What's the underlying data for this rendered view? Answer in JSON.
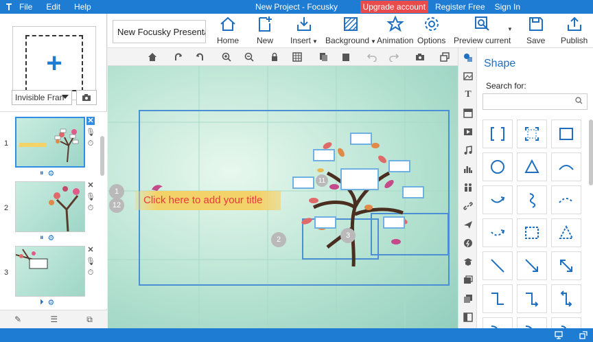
{
  "titlebar": {
    "menu": [
      "File",
      "Edit",
      "Help"
    ],
    "title": "New Project - Focusky",
    "upgrade": "Upgrade account",
    "register": "Register Free",
    "signin": "Sign In"
  },
  "toolbar": {
    "project_name": "New Focusky Presenta",
    "buttons": {
      "home": "Home",
      "new": "New",
      "insert": "Insert",
      "background": "Background",
      "animation": "Animation",
      "options": "Options",
      "preview": "Preview current",
      "save": "Save",
      "publish": "Publish"
    }
  },
  "left_panel": {
    "frame_type": "Invisible Fran",
    "slides": [
      {
        "number": "1",
        "selected": true
      },
      {
        "number": "2",
        "selected": false
      },
      {
        "number": "3",
        "selected": false
      }
    ]
  },
  "canvas": {
    "title_placeholder": "Click here to add your title",
    "bubbles": [
      "1",
      "12",
      "2",
      "3",
      "11"
    ]
  },
  "shape_panel": {
    "title": "Shape",
    "search_label": "Search for:",
    "search_value": ""
  },
  "colors": {
    "accent": "#1e7cd3",
    "upgrade": "#e94b4b",
    "title_text": "#e8393c",
    "title_bg": "#f4d26a"
  }
}
